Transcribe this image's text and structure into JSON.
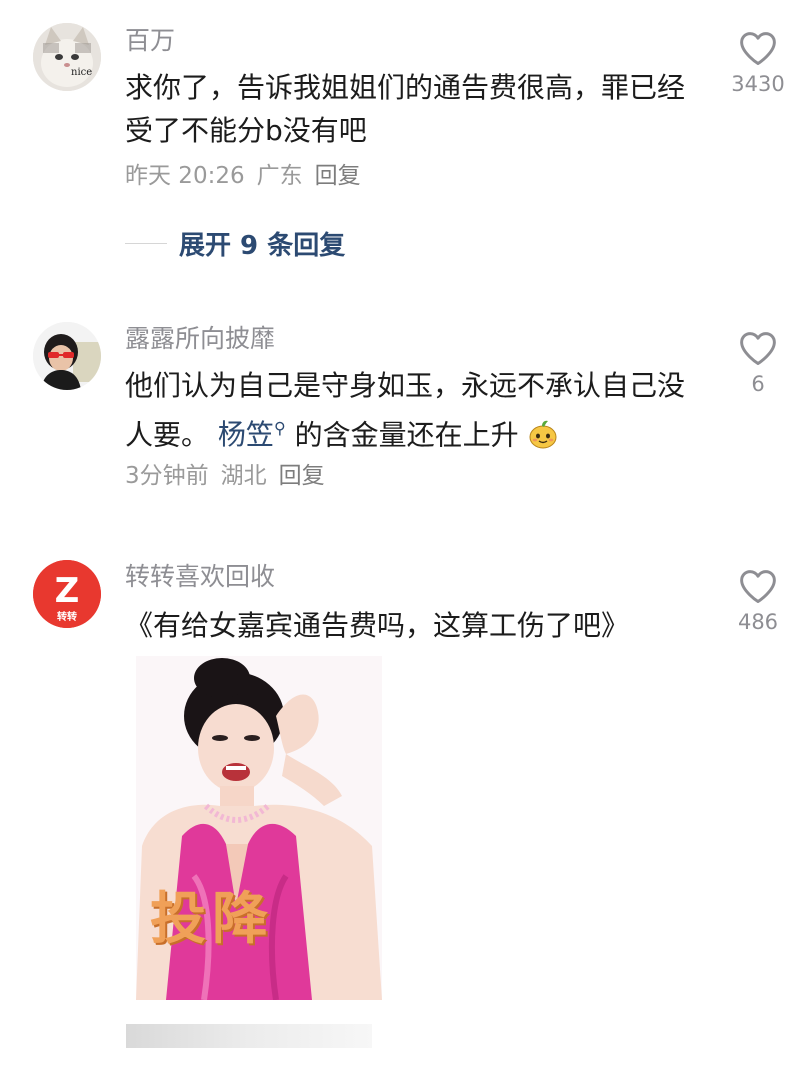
{
  "comments": [
    {
      "username": "百万",
      "avatar_label": "nice",
      "text": "求你了，告诉我姐姐们的通告费很高，罪已经受了不能分b没有吧",
      "time": "昨天 20:26",
      "location": "广东",
      "reply_label": "回复",
      "likes": "3430",
      "expand_label": "展开 9 条回复"
    },
    {
      "username": "露露所向披靡",
      "text_before": "他们认为自己是守身如玉，永远不承认自己没人要。",
      "mention": "杨笠",
      "text_after": "的含金量还在上升",
      "emoji": "smiling-fruit-emoji",
      "time": "3分钟前",
      "location": "湖北",
      "reply_label": "回复",
      "likes": "6"
    },
    {
      "username": "转转喜欢回收",
      "avatar_letter": "Z",
      "avatar_caption": "转转",
      "text": "《有给女嘉宾通告费吗，这算工伤了吧》",
      "likes": "486",
      "image_caption": "投降"
    }
  ],
  "colors": {
    "username": "#8e8e93",
    "mention": "#2c4a72",
    "zhuanzhuan_brand": "#e8382f",
    "meme_dress": "#e0399a"
  },
  "icons": {
    "like": "heart-outline-icon",
    "search": "magnifier-icon"
  }
}
